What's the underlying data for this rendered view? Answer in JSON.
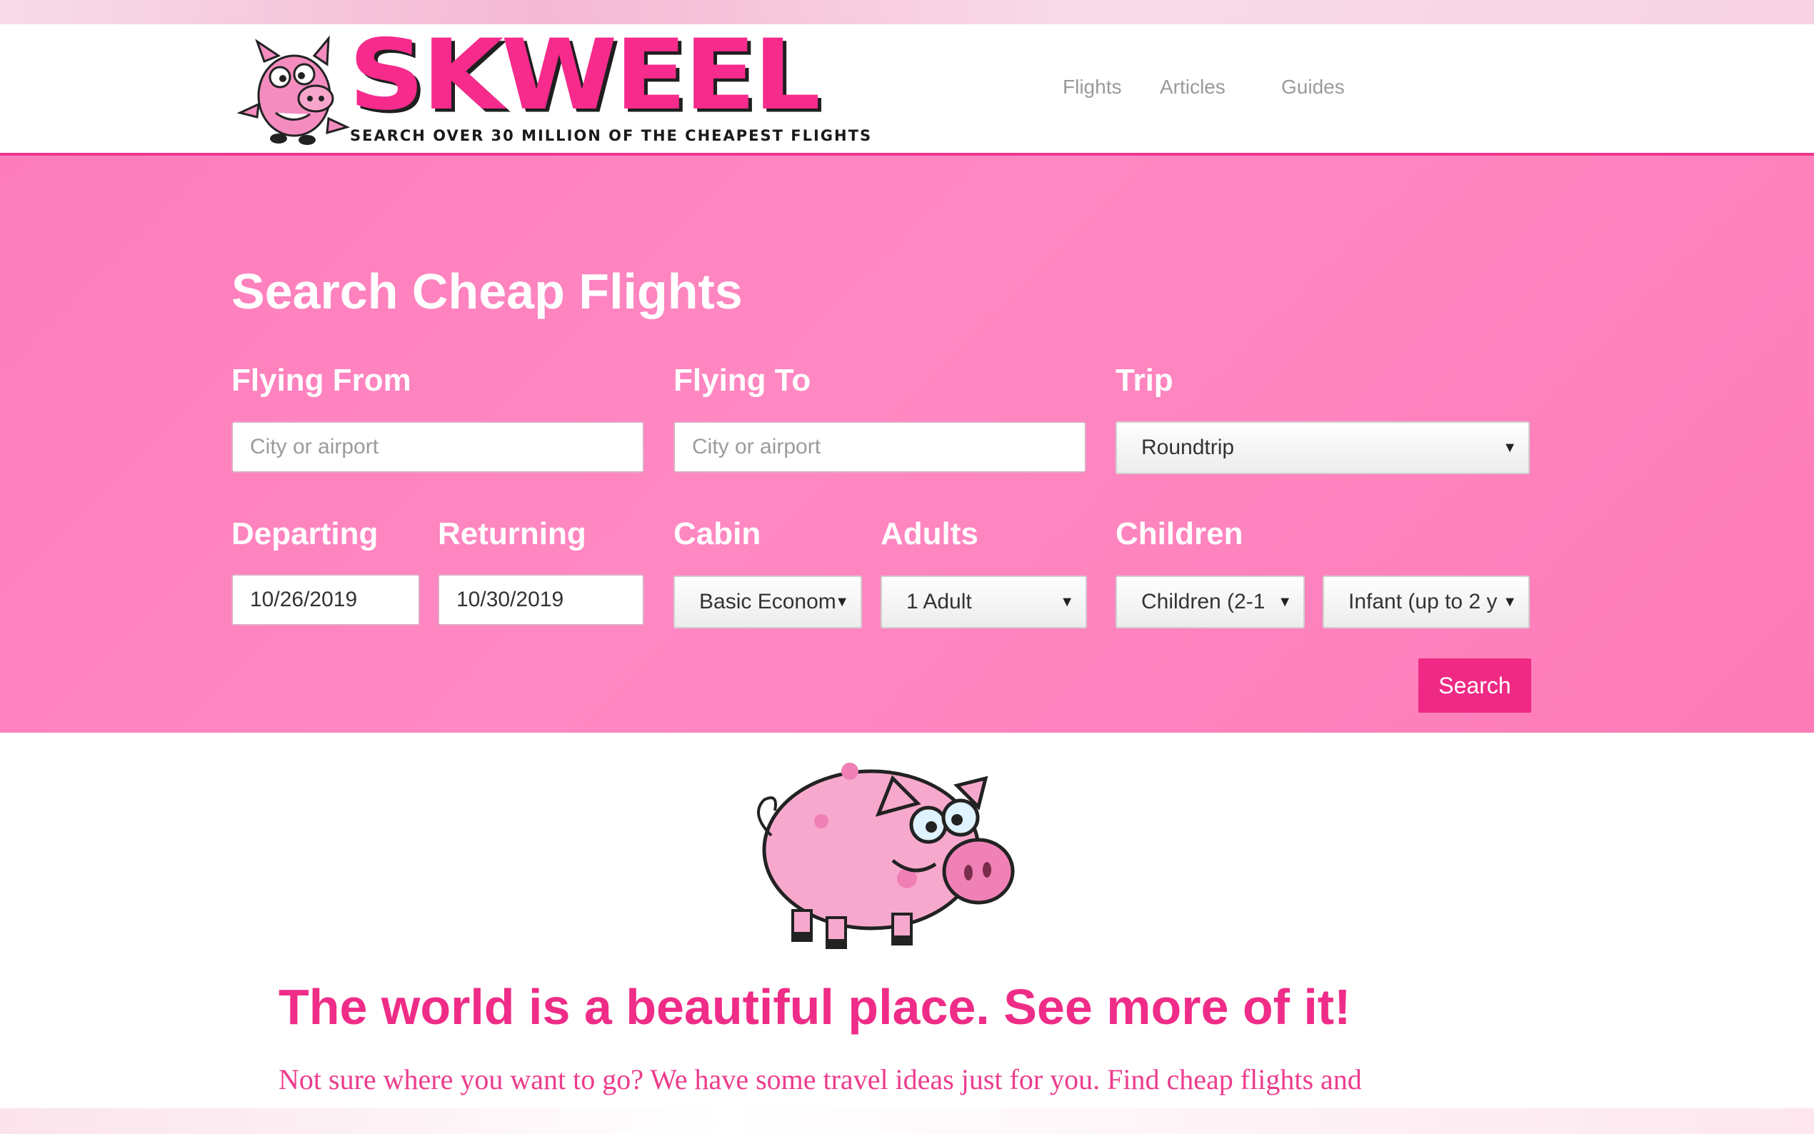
{
  "brand": {
    "name": "SKWEEL",
    "tagline": "SEARCH OVER 30 MILLION OF THE CHEAPEST FLIGHTS",
    "logo_icon": "pig-mascot-icon"
  },
  "nav": {
    "items": [
      {
        "label": "Flights"
      },
      {
        "label": "Articles"
      },
      {
        "label": "Guides"
      }
    ]
  },
  "search": {
    "title": "Search Cheap Flights",
    "from": {
      "label": "Flying From",
      "placeholder": "City or airport"
    },
    "to": {
      "label": "Flying To",
      "placeholder": "City or airport"
    },
    "trip": {
      "label": "Trip",
      "value": "Roundtrip"
    },
    "departing": {
      "label": "Departing",
      "value": "10/26/2019"
    },
    "returning": {
      "label": "Returning",
      "value": "10/30/2019"
    },
    "cabin": {
      "label": "Cabin",
      "value": "Basic Econom"
    },
    "adults": {
      "label": "Adults",
      "value": "1 Adult"
    },
    "children": {
      "label": "Children",
      "value": "Children (2-1",
      "infant_value": "Infant (up to 2 y"
    },
    "button": "Search",
    "dropdown_icon": "▼"
  },
  "main": {
    "illustration": "pig-icon",
    "headline": "The world is a beautiful place. See more of it!",
    "intro": "Not sure where you want to go? We have some travel ideas just for you. Find cheap flights and"
  },
  "colors": {
    "accent": "#ef2c87",
    "hero_bg": "#fd7dbb",
    "button": "#ee2a85"
  }
}
